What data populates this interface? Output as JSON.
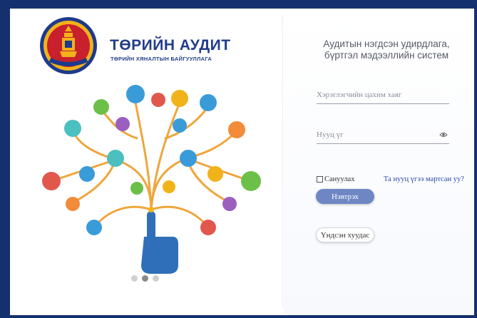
{
  "brand": {
    "title": "ТӨРИЙН АУДИТ",
    "subtitle": "ТӨРИЙН ХЯНАЛТЫН БАЙГУУЛЛАГА",
    "emblem_text": "ТӨРИЙН АУДИТ"
  },
  "system_title": "Аудитын нэгдсэн удирдлага, бүртгэл мэдээллийн систем",
  "login": {
    "email_placeholder": "Хэрэглэгчийн цахим хаяг",
    "password_placeholder": "Нууц үг",
    "remember_label": "Сануулах",
    "forgot_label": "Та нууц үгээ мартсан уу?",
    "login_label": "Нэвтрэх",
    "register_label": "Үндсэн хуудас"
  },
  "carousel": {
    "slides": 3,
    "active_index": 1
  },
  "colors": {
    "background": "#15306e",
    "brand_blue": "#223c8a",
    "button_blue": "#6f86c4",
    "link_blue": "#2c4aa8",
    "tree_orange": "#f0a53c"
  },
  "icons": [
    "eye-icon",
    "emblem-icon",
    "pointing-hand-icon"
  ]
}
